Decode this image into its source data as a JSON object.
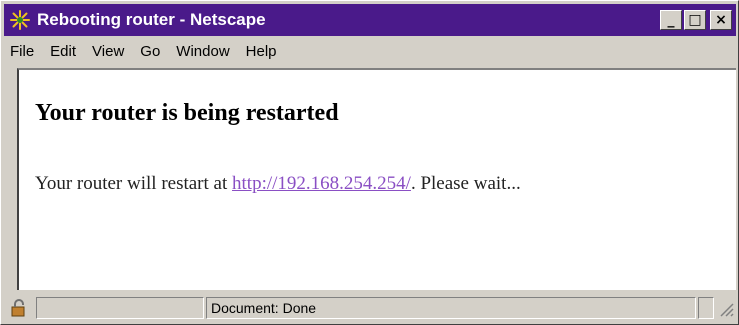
{
  "window": {
    "title": "Rebooting router - Netscape",
    "title_color": "#4a1a8a"
  },
  "window_buttons": {
    "minimize": "_",
    "maximize": "□",
    "close": "×"
  },
  "menu": [
    "File",
    "Edit",
    "View",
    "Go",
    "Window",
    "Help"
  ],
  "page": {
    "heading": "Your router is being restarted",
    "text_before": "Your router will restart at ",
    "link": "http://192.168.254.254/",
    "text_after": ". Please wait...",
    "link_color": "#8a4fc4"
  },
  "status": {
    "text": "Document: Done"
  },
  "icons": [
    "netscape-app-icon",
    "security-lock-icon",
    "resize-grip-icon"
  ]
}
